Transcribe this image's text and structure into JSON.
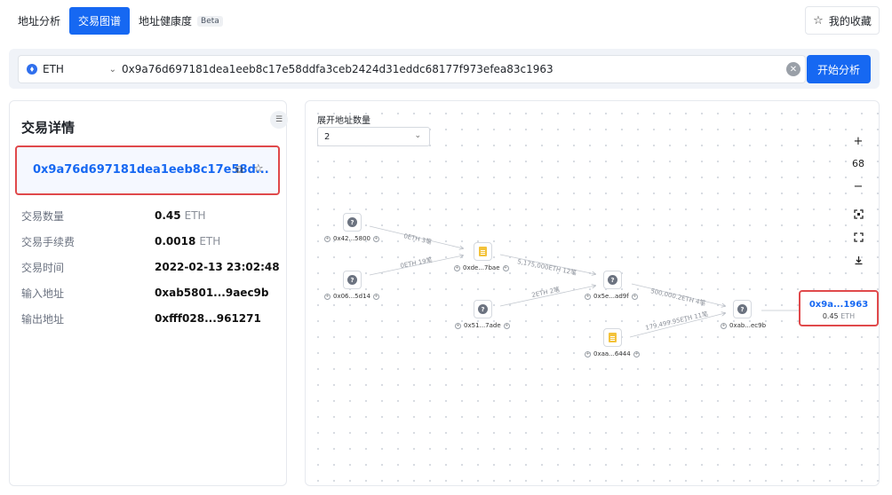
{
  "tabs": [
    {
      "label": "地址分析"
    },
    {
      "label": "交易图谱"
    },
    {
      "label": "地址健康度",
      "badge": "Beta"
    }
  ],
  "favorites_button": {
    "label": "我的收藏",
    "icon": "star-outline-icon"
  },
  "search": {
    "chain": "ETH",
    "value": "0x9a76d697181dea1eeb8c17e58ddfa3ceb2424d31eddc68177f973efea83c1963",
    "button_label": "开始分析"
  },
  "details": {
    "title": "交易详情",
    "hash_display": "0x9a76d697181dea1eeb8c17e58d...",
    "rows": [
      {
        "label": "交易数量",
        "value": "0.45",
        "unit": "ETH"
      },
      {
        "label": "交易手续费",
        "value": "0.0018",
        "unit": "ETH"
      },
      {
        "label": "交易时间",
        "value": "2022-02-13 23:02:48",
        "unit": ""
      },
      {
        "label": "输入地址",
        "value": "0xab5801...9aec9b",
        "unit": ""
      },
      {
        "label": "输出地址",
        "value": "0xfff028...961271",
        "unit": ""
      }
    ]
  },
  "graph": {
    "expand_label": "展开地址数量",
    "expand_value": "2",
    "zoom": "68",
    "controls": {
      "zoom_in": "+",
      "zoom_out": "−"
    },
    "nodes": [
      {
        "id": "n1",
        "label": "0x42...5800",
        "type": "unknown-address"
      },
      {
        "id": "n2",
        "label": "0x06...5d14",
        "type": "unknown-address"
      },
      {
        "id": "n3",
        "label": "0xde...7bae",
        "type": "contract"
      },
      {
        "id": "n4",
        "label": "0x51...7ade",
        "type": "unknown-address"
      },
      {
        "id": "n5",
        "label": "0x5e...ad9f",
        "type": "unknown-address"
      },
      {
        "id": "n6",
        "label": "0xaa...6444",
        "type": "contract"
      },
      {
        "id": "n7",
        "label": "0xab...ec9b",
        "type": "unknown-address"
      }
    ],
    "edges": [
      {
        "from": "n1",
        "to": "n3",
        "label": "0ETH 3笔"
      },
      {
        "from": "n2",
        "to": "n3",
        "label": "0ETH 19笔"
      },
      {
        "from": "n3",
        "to": "n5",
        "label": "5,175,000ETH 12笔"
      },
      {
        "from": "n4",
        "to": "n5",
        "label": "2ETH 2笔"
      },
      {
        "from": "n5",
        "to": "n7",
        "label": "500,000.2ETH 4笔"
      },
      {
        "from": "n6",
        "to": "n7",
        "label": "179,499.95ETH 11笔"
      }
    ],
    "target": {
      "label": "0x9a...1963",
      "amount": "0.45",
      "unit": "ETH"
    }
  },
  "colors": {
    "accent": "#1668f2",
    "highlight_border": "#e0494b",
    "contract_icon": "#f3c23a",
    "unknown_icon": "#6c7380"
  }
}
